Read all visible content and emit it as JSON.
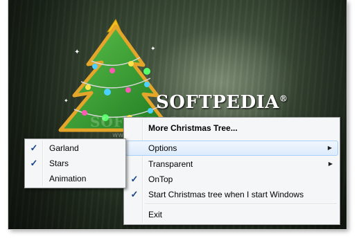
{
  "desktop": {
    "brand_text": "SOFTPEDIA",
    "brand_mark": "®",
    "brand_ghost": "SOFTPEDIA",
    "brand_url": "www.softpedia.com"
  },
  "main_menu": {
    "items": [
      {
        "label": "More Christmas Tree...",
        "bold": true,
        "checked": false,
        "submenu": false
      },
      {
        "label": "Options",
        "checked": false,
        "submenu": true,
        "highlighted": true
      },
      {
        "label": "Transparent",
        "checked": false,
        "submenu": true
      },
      {
        "label": "OnTop",
        "checked": true,
        "submenu": false
      },
      {
        "label": "Start Christmas tree when I start Windows",
        "checked": true,
        "submenu": false
      },
      {
        "label": "Exit",
        "checked": false,
        "submenu": false
      }
    ]
  },
  "options_submenu": {
    "items": [
      {
        "label": "Garland",
        "checked": true
      },
      {
        "label": "Stars",
        "checked": true
      },
      {
        "label": "Animation",
        "checked": false
      }
    ]
  },
  "glyphs": {
    "check": "✓",
    "arrow": "▶"
  },
  "colors": {
    "tree": "#2f9a2c",
    "highlight": "#dcebfc",
    "check": "#15428b"
  }
}
